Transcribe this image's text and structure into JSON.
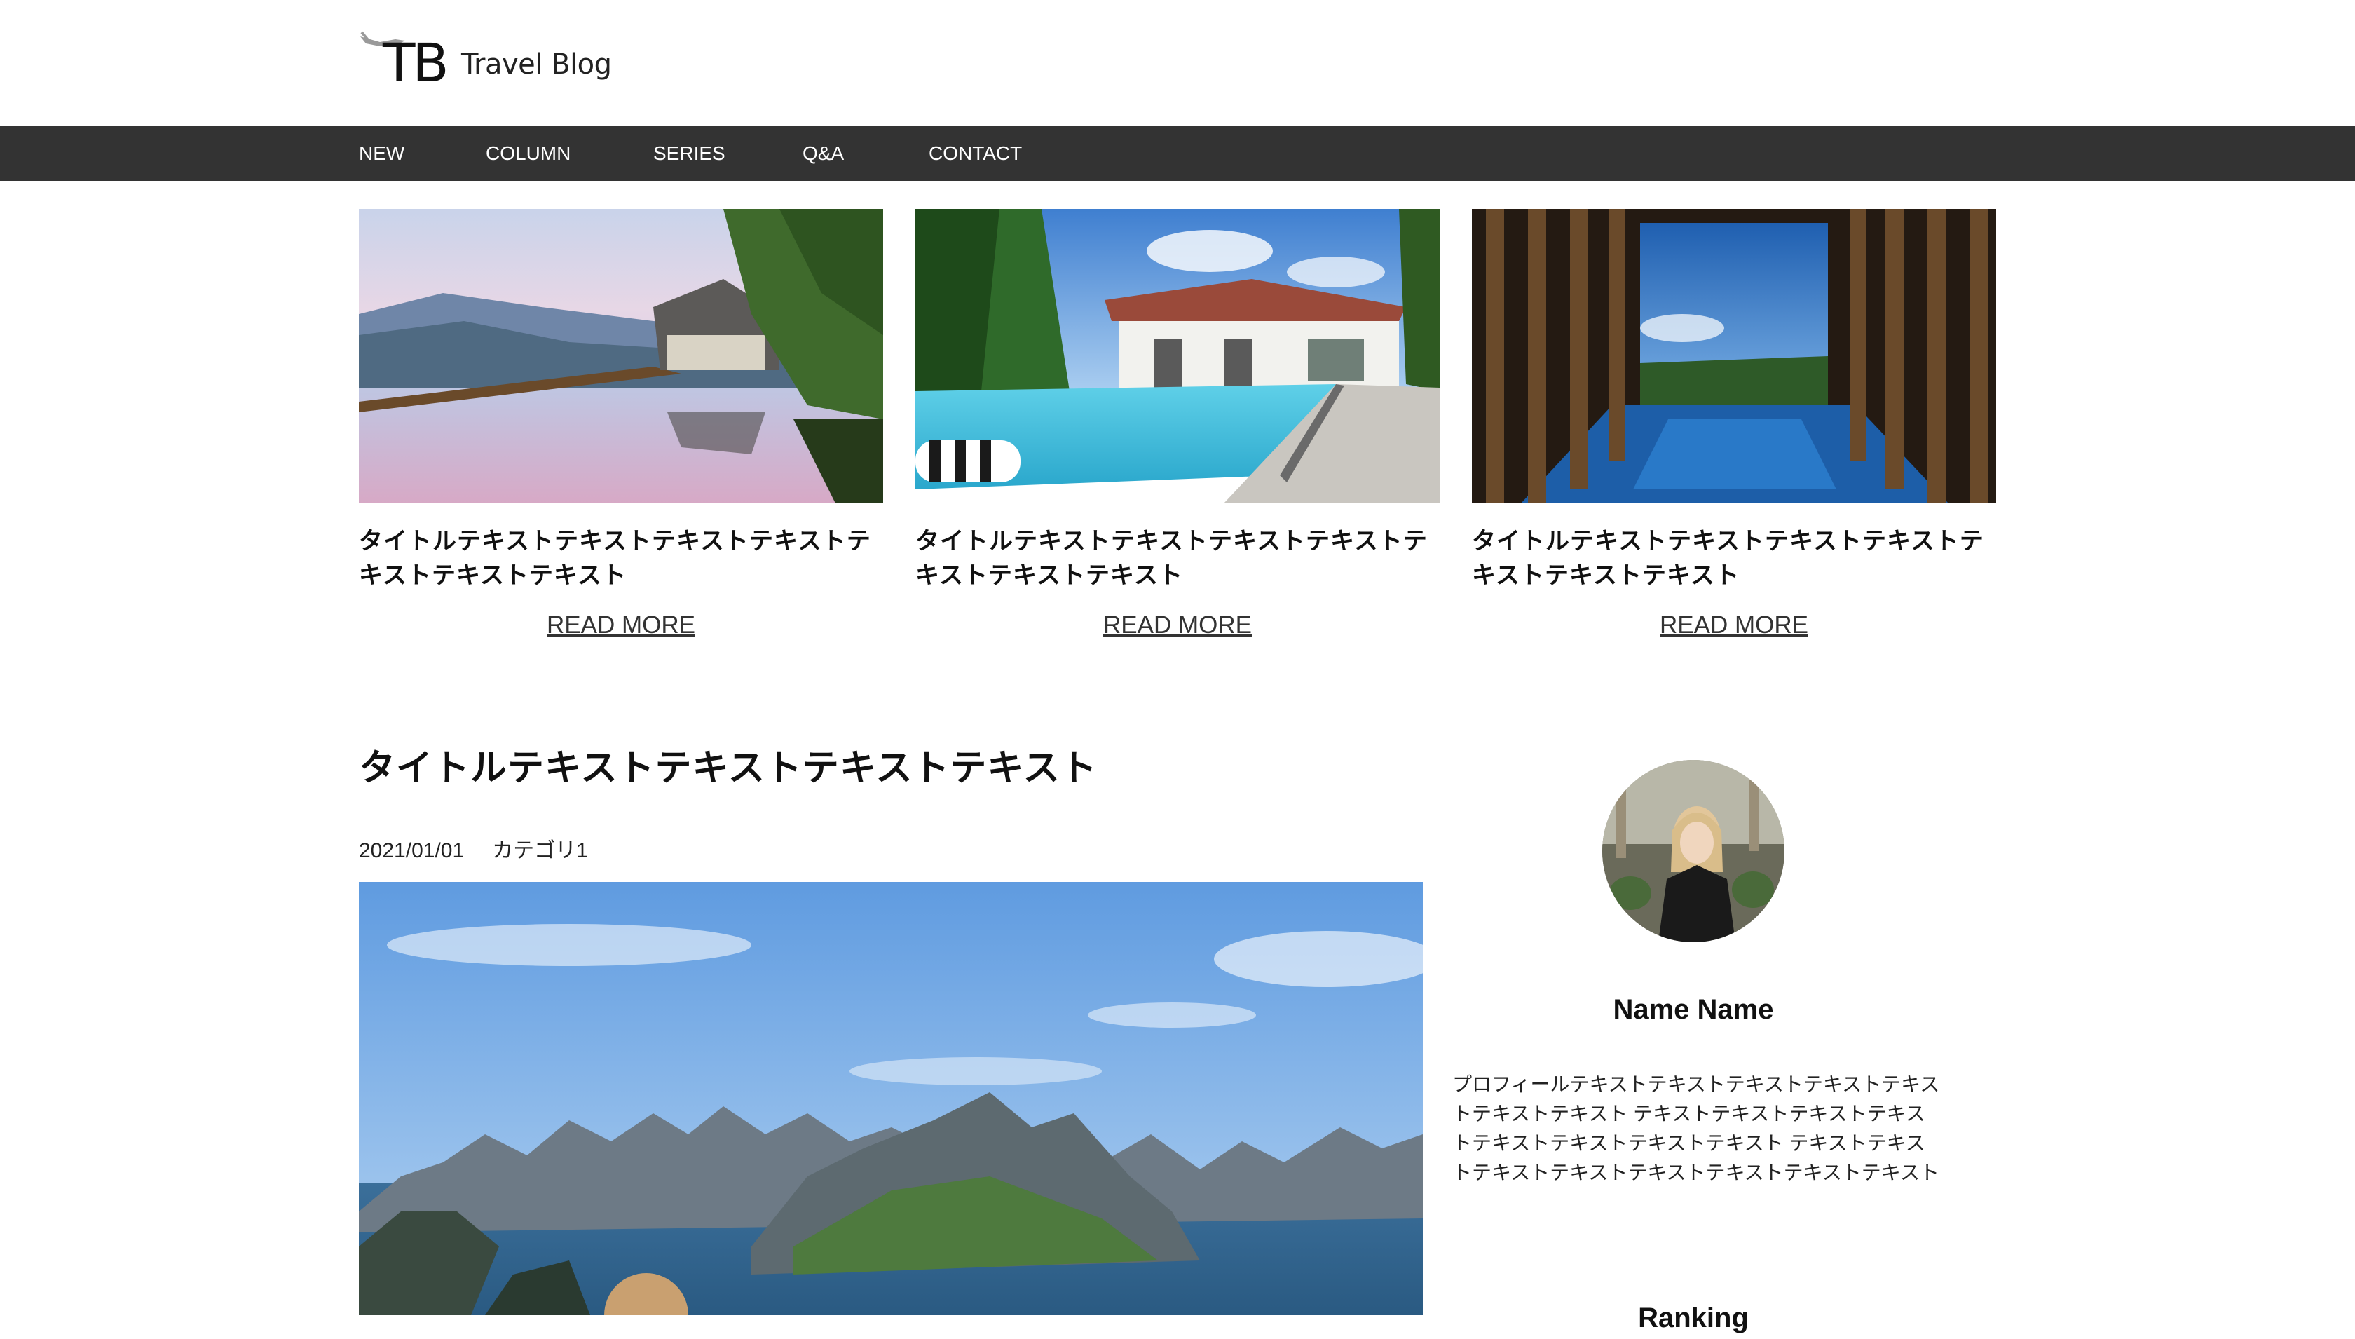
{
  "header": {
    "logo_mark": "TB",
    "logo_text": "Travel Blog"
  },
  "nav": {
    "items": [
      {
        "label": "NEW"
      },
      {
        "label": "COLUMN"
      },
      {
        "label": "SERIES"
      },
      {
        "label": "Q&A"
      },
      {
        "label": "CONTACT"
      }
    ]
  },
  "cards": [
    {
      "title": "タイトルテキストテキストテキストテキストテキストテキストテキスト",
      "read_more": "READ MORE",
      "image": "mountain-lake-house-photo"
    },
    {
      "title": "タイトルテキストテキストテキストテキストテキストテキストテキスト",
      "read_more": "READ MORE",
      "image": "resort-pool-villa-photo"
    },
    {
      "title": "タイトルテキストテキストテキストテキストテキストテキストテキスト",
      "read_more": "READ MORE",
      "image": "infinity-pool-corridor-photo"
    }
  ],
  "article": {
    "title": "タイトルテキストテキストテキストテキスト",
    "date": "2021/01/01",
    "category": "カテゴリ1",
    "image": "fjord-mountains-photo"
  },
  "sidebar": {
    "avatar": "profile-avatar-photo",
    "name": "Name Name",
    "profile_text": "プロフィールテキストテキストテキストテキストテキストテキストテキスト テキストテキストテキストテキストテキストテキストテキストテキスト テキストテキストテキストテキストテキストテキストテキストテキスト",
    "next_heading": "Ranking"
  },
  "colors": {
    "nav_background": "#333333",
    "nav_text": "#ffffff",
    "page_background": "#ffffff"
  }
}
